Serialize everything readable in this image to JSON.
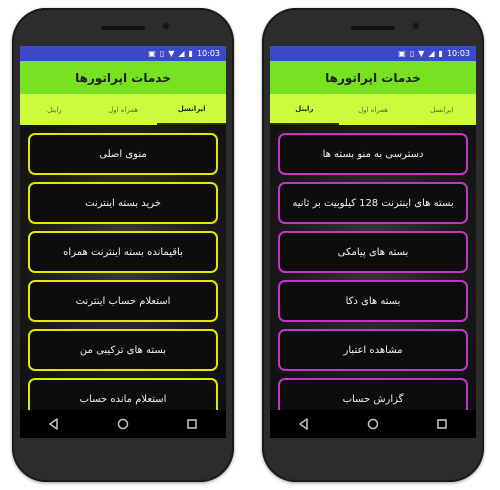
{
  "left_phone": {
    "status": {
      "time": "10:03"
    },
    "app_title": "خدمات اپراتورها",
    "tabs": [
      {
        "label": "رایتل",
        "active": false
      },
      {
        "label": "همراه اول",
        "active": false
      },
      {
        "label": "ایرانسل",
        "active": true
      }
    ],
    "accent": "#e6e600",
    "buttons": [
      {
        "label": "منوی اصلی"
      },
      {
        "label": "خرید بسته اینترنت"
      },
      {
        "label": "باقیمانده بسته اینترنت همراه"
      },
      {
        "label": "استعلام حساب اینترنت"
      },
      {
        "label": "بسته های ترکیبی من"
      },
      {
        "label": "استعلام مانده حساب"
      }
    ]
  },
  "right_phone": {
    "status": {
      "time": "10:03"
    },
    "app_title": "خدمات اپراتورها",
    "tabs": [
      {
        "label": "رایتل",
        "active": true
      },
      {
        "label": "همراه اول",
        "active": false
      },
      {
        "label": "ایرانسل",
        "active": false
      }
    ],
    "accent": "#c633c6",
    "buttons": [
      {
        "label": "دسترسی به منو بسته ها"
      },
      {
        "label": "بسته های اینترنت 128 کیلوبیت بر ثانیه"
      },
      {
        "label": "بسته های پیامکی"
      },
      {
        "label": "بسته های دکا"
      },
      {
        "label": "مشاهده اعتبار"
      },
      {
        "label": "گزارش حساب"
      }
    ]
  }
}
